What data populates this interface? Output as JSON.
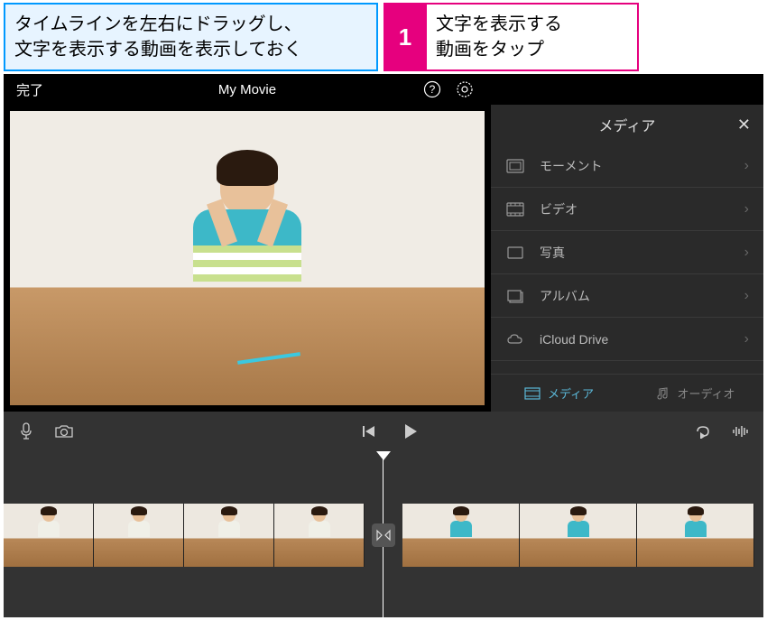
{
  "callouts": {
    "left": "タイムラインを左右にドラッグし、\n文字を表示する動画を表示しておく",
    "step_num": "1",
    "right": "文字を表示する\n動画をタップ"
  },
  "topbar": {
    "done_label": "完了",
    "title": "My Movie"
  },
  "media": {
    "header": "メディア",
    "items": [
      {
        "label": "モーメント",
        "icon": "moments-icon"
      },
      {
        "label": "ビデオ",
        "icon": "video-icon"
      },
      {
        "label": "写真",
        "icon": "photo-icon"
      },
      {
        "label": "アルバム",
        "icon": "album-icon"
      },
      {
        "label": "iCloud Drive",
        "icon": "cloud-icon"
      }
    ],
    "tabs": {
      "media": "メディア",
      "audio": "オーディオ"
    }
  }
}
